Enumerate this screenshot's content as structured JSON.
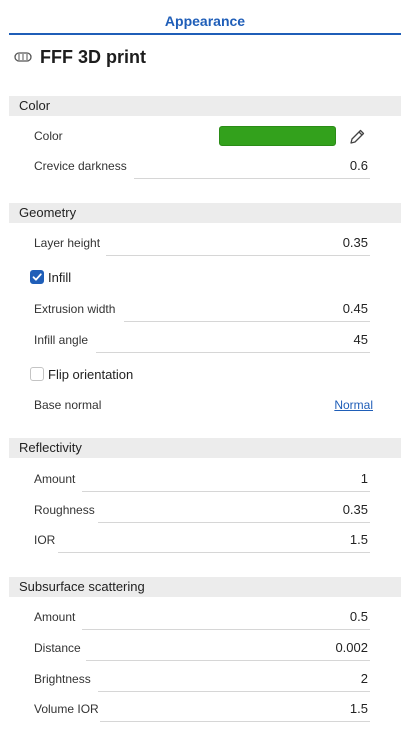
{
  "tab": {
    "title": "Appearance"
  },
  "header": {
    "title": "FFF 3D print",
    "icon": "print-material-icon"
  },
  "colors": {
    "accent": "#1f5eb8",
    "swatch": "#33a11c",
    "section_bg": "#ececec"
  },
  "sections": {
    "color": {
      "title": "Color",
      "color_label": "Color",
      "crevice_label": "Crevice darkness",
      "crevice_value": "0.6"
    },
    "geometry": {
      "title": "Geometry",
      "layer_height_label": "Layer height",
      "layer_height_value": "0.35",
      "infill_label": "Infill",
      "infill_checked": true,
      "extrusion_label": "Extrusion width",
      "extrusion_value": "0.45",
      "infill_angle_label": "Infill angle",
      "infill_angle_value": "45",
      "flip_label": "Flip orientation",
      "flip_checked": false,
      "base_normal_label": "Base normal",
      "base_normal_value": "Normal"
    },
    "reflectivity": {
      "title": "Reflectivity",
      "amount_label": "Amount",
      "amount_value": "1",
      "roughness_label": "Roughness",
      "roughness_value": "0.35",
      "ior_label": "IOR",
      "ior_value": "1.5"
    },
    "subsurface": {
      "title": "Subsurface scattering",
      "amount_label": "Amount",
      "amount_value": "0.5",
      "distance_label": "Distance",
      "distance_value": "0.002",
      "brightness_label": "Brightness",
      "brightness_value": "2",
      "volume_ior_label": "Volume IOR",
      "volume_ior_value": "1.5"
    }
  }
}
